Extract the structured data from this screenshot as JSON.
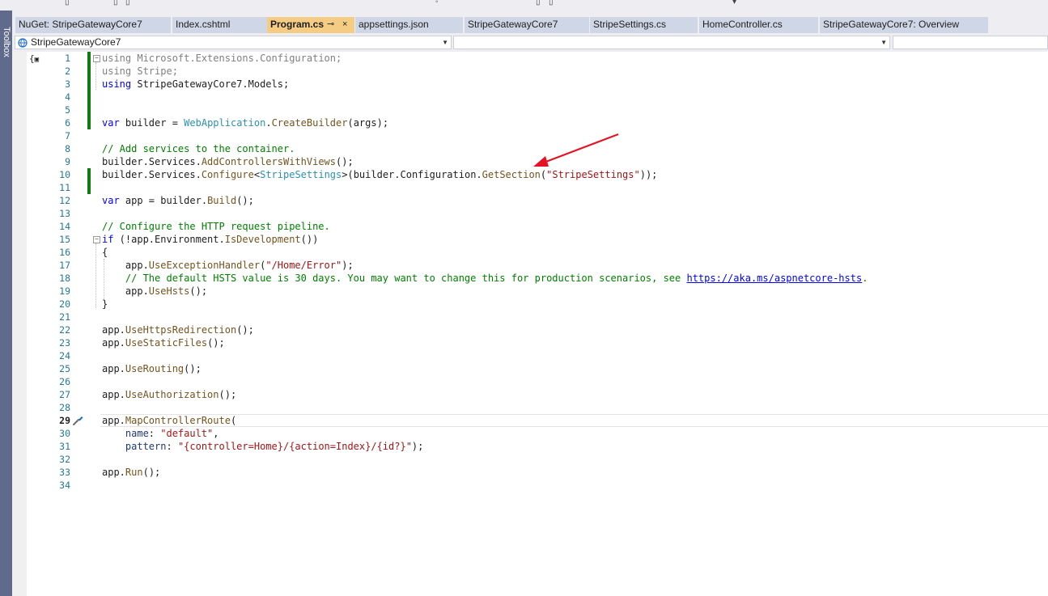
{
  "toolbox": {
    "label": "Toolbox"
  },
  "tabs": [
    {
      "label": "NuGet: StripeGatewayCore7",
      "active": false
    },
    {
      "label": "Index.cshtml",
      "active": false
    },
    {
      "label": "Program.cs",
      "active": true
    },
    {
      "label": "appsettings.json",
      "active": false
    },
    {
      "label": "StripeGatewayCore7",
      "active": false
    },
    {
      "label": "StripeSettings.cs",
      "active": false
    },
    {
      "label": "HomeController.cs",
      "active": false
    },
    {
      "label": "StripeGatewayCore7: Overview",
      "active": false
    }
  ],
  "tab_icons": {
    "pin": "⊸",
    "close": "×"
  },
  "navbar": {
    "project": "StripeGatewayCore7",
    "member": "",
    "member2": ""
  },
  "gutter": {
    "current_line": "29"
  },
  "colors": {
    "accent_tab": "#f5cc84",
    "change_marker": "#107c10",
    "annotation_arrow": "#e81123"
  },
  "code": {
    "l1a": "using",
    "l1b": " Microsoft.Extensions.Configuration;",
    "l2a": "using",
    "l2b": " Stripe;",
    "l3a": "using",
    "l3b": " StripeGatewayCore7.Models;",
    "l6a": "var",
    "l6b": " builder = ",
    "l6c": "WebApplication",
    "l6d": ".",
    "l6e": "CreateBuilder",
    "l6f": "(args);",
    "l8": "// Add services to the container.",
    "l9a": "builder.Services.",
    "l9b": "AddControllersWithViews",
    "l9c": "();",
    "l10a": "builder.Services.",
    "l10b": "Configure",
    "l10c": "<",
    "l10d": "StripeSettings",
    "l10e": ">(builder.Configuration.",
    "l10f": "GetSection",
    "l10g": "(",
    "l10h": "\"StripeSettings\"",
    "l10i": "));",
    "l12a": "var",
    "l12b": " app = builder.",
    "l12c": "Build",
    "l12d": "();",
    "l14": "// Configure the HTTP request pipeline.",
    "l15a": "if",
    "l15b": " (!app.Environment.",
    "l15c": "IsDevelopment",
    "l15d": "())",
    "l16": "{",
    "l17a": "    app.",
    "l17b": "UseExceptionHandler",
    "l17c": "(",
    "l17d": "\"/Home/Error\"",
    "l17e": ");",
    "l18a": "    // The default HSTS value is 30 days. You may want to change this for production scenarios, see ",
    "l18b": "https://aka.ms/aspnetcore-hsts",
    "l18c": ".",
    "l19a": "    app.",
    "l19b": "UseHsts",
    "l19c": "();",
    "l20": "}",
    "l22a": "app.",
    "l22b": "UseHttpsRedirection",
    "l22c": "();",
    "l23a": "app.",
    "l23b": "UseStaticFiles",
    "l23c": "();",
    "l25a": "app.",
    "l25b": "UseRouting",
    "l25c": "();",
    "l27a": "app.",
    "l27b": "UseAuthorization",
    "l27c": "();",
    "l29a": "app.",
    "l29b": "MapControllerRoute",
    "l29c": "(",
    "l30a": "    name",
    "l30b": ": ",
    "l30c": "\"default\"",
    "l30d": ",",
    "l31a": "    pattern",
    "l31b": ": ",
    "l31c": "\"{controller=Home}/{action=Index}/{id?}\"",
    "l31d": ");",
    "l33a": "app.",
    "l33b": "Run",
    "l33c": "();"
  },
  "line_numbers": [
    "1",
    "2",
    "3",
    "4",
    "5",
    "6",
    "7",
    "8",
    "9",
    "10",
    "11",
    "12",
    "13",
    "14",
    "15",
    "16",
    "17",
    "18",
    "19",
    "20",
    "21",
    "22",
    "23",
    "24",
    "25",
    "26",
    "27",
    "28",
    "29",
    "30",
    "31",
    "32",
    "33",
    "34"
  ],
  "icons": {
    "scope": "scope-icon",
    "screwdriver": "screwdriver-icon",
    "project": "csharp-project-icon"
  }
}
